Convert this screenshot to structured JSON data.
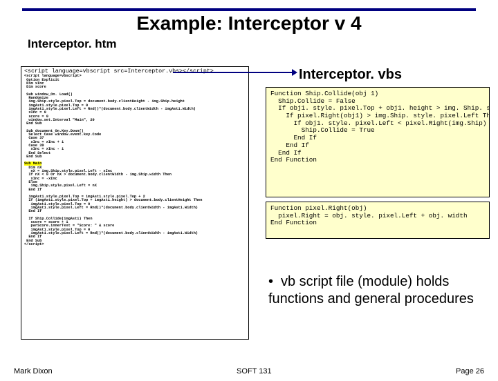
{
  "slide": {
    "title": "Example: Interceptor v 4",
    "filename1": "Interceptor. htm",
    "filename2": "Interceptor. vbs",
    "bullet": "vb script file (module) holds functions and general procedures"
  },
  "code1": {
    "top": "<script language=vbscript src=Interceptor.vbs></script>",
    "body_part1": "<script language=vbscript>\n Option Explicit\n Dim xInc\n Dim score\n\n Sub window_On. Load()\n  Randomize\n  img.Ship.style.pixel.Top = document.body.clientHeight - img.Ship.height\n  imgAst1.style.pixel.Top = 0\n  imgAst1.style.pixel.Left = Rnd()*(document.body.clientWidth - imgAst1.Width)\n  xInc = 0\n  score = 0\n  window.set.Interval \"Main\", 20\n End Sub\n\n Sub document_On.Key.Down()\n  Select Case window.event.key.Code\n  Case 37\n   xInc = xInc + 1\n  Case 39\n   xInc = xInc - 1\n  End Select\n End Sub\n\n",
    "hl_label": "Sub Main",
    "body_part2": "\n  Dim nX\n   nX = img.Ship.style.pixel.Left - xInc\n  If nX < 0 Or nX > document.body.clientWidth - img.Ship.width Then\n   xInc = -xInc\n  Else\n   img.Ship.style.pixel.Left = nX\n  End If\n\n  imgAst1.style.pixel.Top = imgAst1.style.pixel.Top + 2\n  If (imgAst1.style.pixel.Top + imgAst1.height) > document.body.clientHeight Then\n   imgAst1.style.pixel.Top = 0\n   imgAst1.style.pixel.Left = Rnd()*(document.body.clientWidth - imgAst1.Width)\n  End If\n\n  If Ship.Collide(imgAst1) Then\n   score = score + 1\n   parScore.innerText = \"Score: \" & score\n   imgAst1.style.pixel.Top = 0\n   imgAst1.style.pixel.Left = Rnd()*(document.body.clientWidth - imgAst1.Width)\n  End If\n End Sub\n</script>"
  },
  "code2": "Function Ship.Collide(obj 1)\n  Ship.Collide = False\n  If obj1. style. pixel.Top + obj1. height > img. Ship. style. pixel.Top Th\n    If pixel.Right(obj1) > img.Ship. style. pixel.Left Then\n      If obj1. style. pixel.Left < pixel.Right(img.Ship) Then\n        Ship.Collide = True\n      End If\n    End If\n  End If\nEnd Function",
  "code3": "Function pixel.Right(obj)\n  pixel.Right = obj. style. pixel.Left + obj. width\nEnd Function",
  "footer": {
    "left": "Mark Dixon",
    "center": "SOFT 131",
    "right": "Page 26"
  }
}
